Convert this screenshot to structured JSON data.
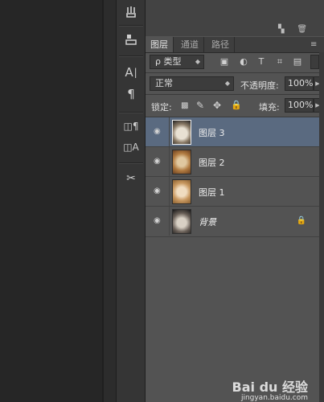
{
  "tabs": [
    "图层",
    "通道",
    "路径"
  ],
  "filter": {
    "label": "ρ 类型"
  },
  "blend": {
    "mode": "正常",
    "opacity_label": "不透明度:",
    "opacity_value": "100%"
  },
  "lock": {
    "label": "锁定:",
    "fill_label": "填充:",
    "fill_value": "100%"
  },
  "layers": [
    {
      "name": "图层 3",
      "selected": true
    },
    {
      "name": "图层 2",
      "selected": false
    },
    {
      "name": "图层 1",
      "selected": false
    },
    {
      "name": "背景",
      "selected": false,
      "locked": true
    }
  ],
  "toolstrip_icons": [
    "brush-presets-icon",
    "clone-source-icon",
    "character-icon",
    "paragraph-icon",
    "char-style-icon",
    "para-style-icon",
    "tool-presets-icon"
  ],
  "watermark": {
    "brand": "Bai du 经验",
    "url": "jingyan.baidu.com"
  },
  "colors": {
    "panel_bg": "#535353",
    "selected_layer": "#5a6a80",
    "toolstrip_bg": "#353535"
  }
}
